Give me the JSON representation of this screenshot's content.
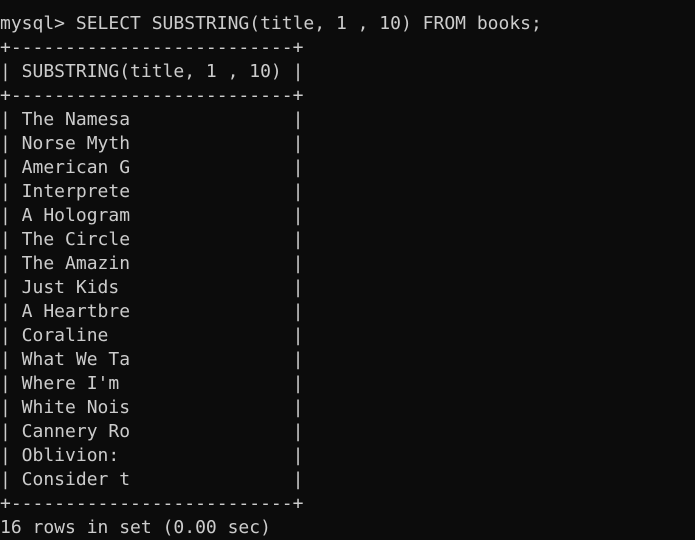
{
  "terminal": {
    "prompt": "mysql> ",
    "command": "SELECT SUBSTRING(title, 1 , 10) FROM books;",
    "border": "+--------------------------+",
    "header": "| SUBSTRING(title, 1 , 10) |",
    "rows": [
      "| The Namesa               |",
      "| Norse Myth               |",
      "| American G               |",
      "| Interprete               |",
      "| A Hologram               |",
      "| The Circle               |",
      "| The Amazin               |",
      "| Just Kids                |",
      "| A Heartbre               |",
      "| Coraline                 |",
      "| What We Ta               |",
      "| Where I'm                |",
      "| White Nois               |",
      "| Cannery Ro               |",
      "| Oblivion:                |",
      "| Consider t               |"
    ],
    "footer": "16 rows in set (0.00 sec)"
  },
  "colors": {
    "background": "#0c0c0c",
    "text": "#cccccc"
  }
}
